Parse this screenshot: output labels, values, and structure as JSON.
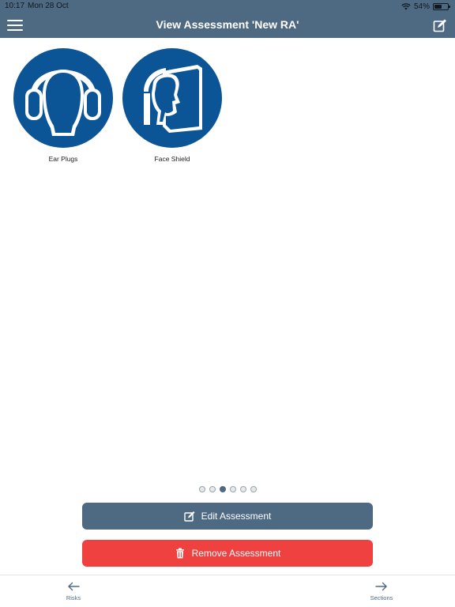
{
  "status_bar": {
    "time": "10:17",
    "date": "Mon 28 Oct",
    "battery_percent": "54%",
    "battery_level": 0.54
  },
  "header": {
    "title": "View Assessment 'New RA'",
    "left_icon": "menu-icon",
    "right_icon": "edit-icon"
  },
  "ppe_items": [
    {
      "label": "Ear Plugs",
      "icon": "ear-protection-icon"
    },
    {
      "label": "Face Shield",
      "icon": "face-shield-icon"
    }
  ],
  "pagination": {
    "total": 6,
    "active_index": 2
  },
  "actions": {
    "edit_label": "Edit Assessment",
    "remove_label": "Remove Assessment"
  },
  "tab_bar": {
    "left_label": "Risks",
    "right_label": "Sections"
  },
  "colors": {
    "header": "#4e6a82",
    "icon_blue": "#0b5496",
    "remove": "#ef4140"
  }
}
